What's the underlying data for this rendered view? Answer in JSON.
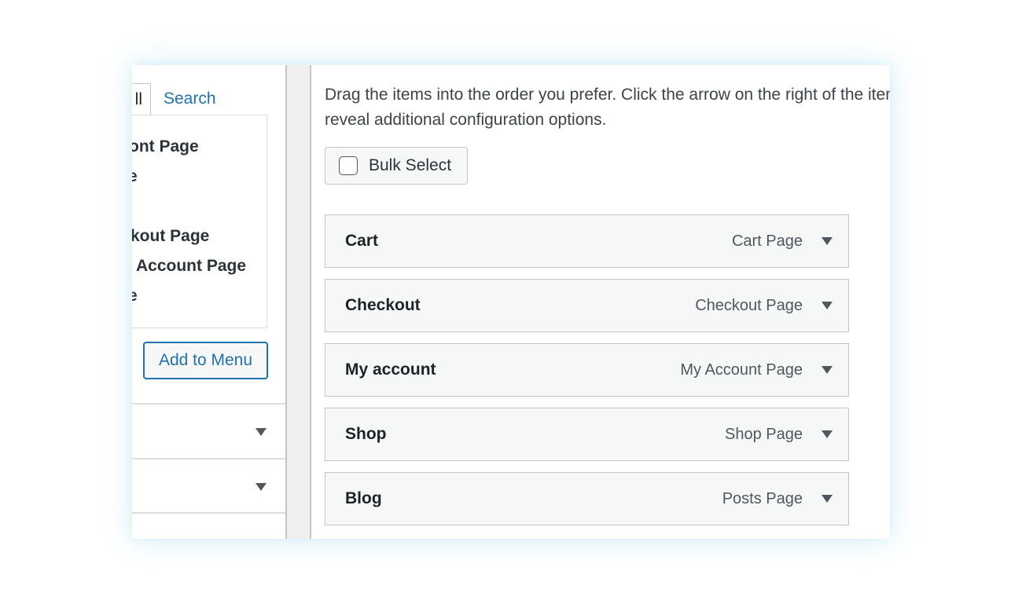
{
  "left_panel": {
    "tabs": [
      {
        "label": "ll"
      },
      {
        "label": "Search"
      }
    ],
    "page_list": [
      "ont Page",
      "e",
      "",
      "kout Page",
      "Account Page",
      "e"
    ],
    "add_to_menu_label": "Add to Menu",
    "accordion_icons": [
      "triangle-down-icon",
      "triangle-down-icon"
    ]
  },
  "right_panel": {
    "instructions": "Drag the items into the order you prefer. Click the arrow on the right of the item to reveal additional configuration options.",
    "bulk_select_label": "Bulk Select",
    "menu_items": [
      {
        "title": "Cart",
        "type": "Cart Page"
      },
      {
        "title": "Checkout",
        "type": "Checkout Page"
      },
      {
        "title": "My account",
        "type": "My Account Page"
      },
      {
        "title": "Shop",
        "type": "Shop Page"
      },
      {
        "title": "Blog",
        "type": "Posts Page"
      }
    ]
  },
  "colors": {
    "link": "#2271b1",
    "text": "#1d2327",
    "muted": "#50575e",
    "item_bg": "#f6f7f7",
    "border": "#c3c4c7",
    "gutter": "#f0f0f1"
  }
}
